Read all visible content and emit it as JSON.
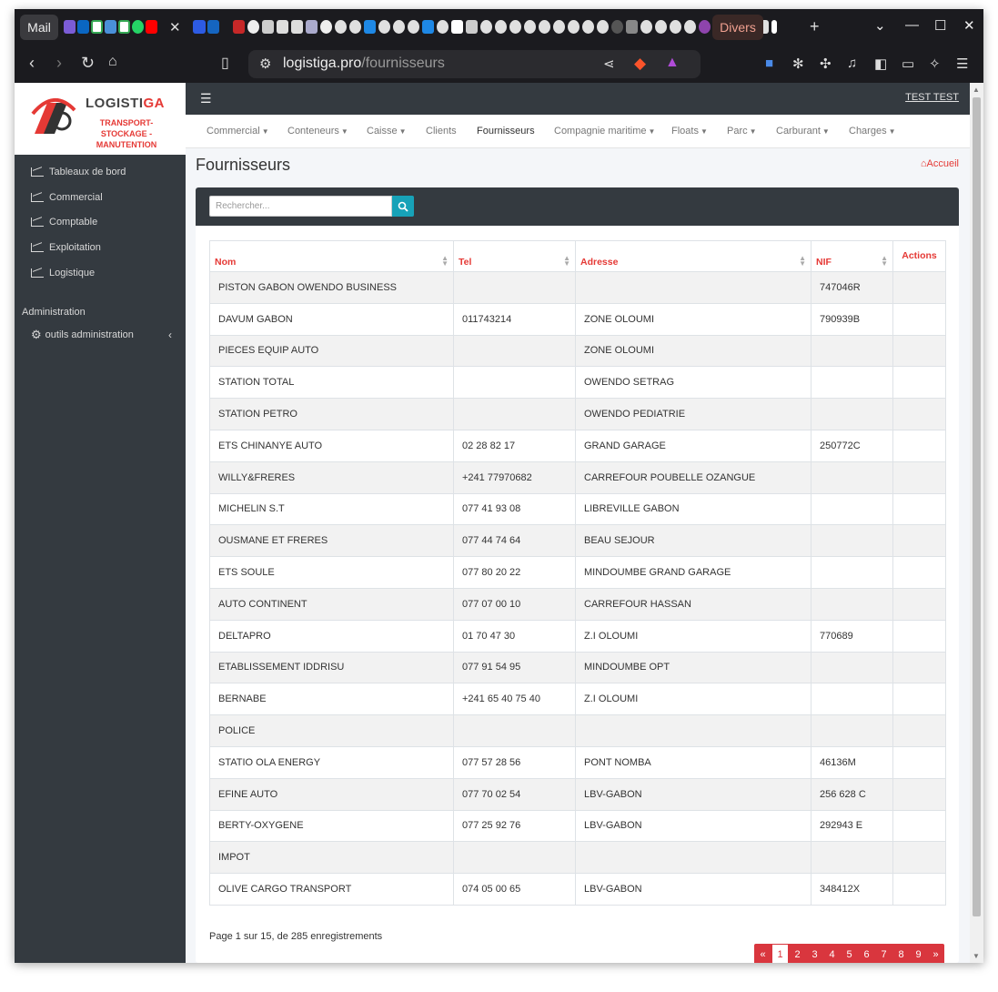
{
  "browser": {
    "tab_mail": "Mail",
    "tab_divers": "Divers",
    "url_host": "logistiga.pro",
    "url_path": "/fournisseurs"
  },
  "brand": {
    "name_main": "LOGISTI",
    "name_accent": "GA",
    "tagline": "TRANSPORT-STOCKAGE -MANUTENTION",
    "accent_color": "#e53935"
  },
  "sidebar": {
    "items": [
      {
        "label": "Tableaux de bord",
        "icon": "chart-line-icon"
      },
      {
        "label": "Commercial",
        "icon": "chart-line-icon"
      },
      {
        "label": "Comptable",
        "icon": "chart-line-icon"
      },
      {
        "label": "Exploitation",
        "icon": "chart-line-icon"
      },
      {
        "label": "Logistique",
        "icon": "chart-line-icon"
      }
    ],
    "section_label": "Administration",
    "admin_item": "outils administration"
  },
  "topbar": {
    "user": "TEST TEST"
  },
  "menu": [
    {
      "label": "Commercial",
      "dropdown": true
    },
    {
      "label": "Conteneurs",
      "dropdown": true
    },
    {
      "label": "Caisse",
      "dropdown": true
    },
    {
      "label": "Clients",
      "dropdown": false
    },
    {
      "label": "Fournisseurs",
      "dropdown": false,
      "active": true
    },
    {
      "label": "Compagnie maritime",
      "dropdown": true
    },
    {
      "label": "Floats",
      "dropdown": true
    },
    {
      "label": "Parc",
      "dropdown": true
    },
    {
      "label": "Carburant",
      "dropdown": true
    },
    {
      "label": "Charges",
      "dropdown": true
    }
  ],
  "page": {
    "title": "Fournisseurs",
    "home_link": "Accueil",
    "search_placeholder": "Rechercher..."
  },
  "table": {
    "columns": [
      "Nom",
      "Tel",
      "Adresse",
      "NIF",
      "Actions"
    ],
    "rows": [
      [
        "PISTON GABON OWENDO BUSINESS",
        "",
        "",
        "747046R"
      ],
      [
        "DAVUM GABON",
        "011743214",
        "ZONE OLOUMI",
        "790939B"
      ],
      [
        "PIECES EQUIP AUTO",
        "",
        "ZONE OLOUMI",
        ""
      ],
      [
        "STATION TOTAL",
        "",
        "OWENDO SETRAG",
        ""
      ],
      [
        "STATION PETRO",
        "",
        "OWENDO PEDIATRIE",
        ""
      ],
      [
        "ETS CHINANYE AUTO",
        "02 28 82 17",
        "GRAND GARAGE",
        "250772C"
      ],
      [
        "WILLY&FRERES",
        "+241 77970682",
        "CARREFOUR POUBELLE OZANGUE",
        ""
      ],
      [
        "MICHELIN S.T",
        "077 41 93 08",
        "LIBREVILLE GABON",
        ""
      ],
      [
        "OUSMANE ET FRERES",
        "077 44 74 64",
        "BEAU SEJOUR",
        ""
      ],
      [
        "ETS SOULE",
        "077 80 20 22",
        "MINDOUMBE GRAND GARAGE",
        ""
      ],
      [
        "AUTO CONTINENT",
        "077 07 00 10",
        "CARREFOUR HASSAN",
        ""
      ],
      [
        "DELTAPRO",
        "01 70 47 30",
        "Z.I OLOUMI",
        "770689"
      ],
      [
        "ETABLISSEMENT IDDRISU",
        "077 91 54 95",
        "MINDOUMBE OPT",
        ""
      ],
      [
        "BERNABE",
        "+241 65 40 75 40",
        "Z.I OLOUMI",
        ""
      ],
      [
        "POLICE",
        "",
        "",
        ""
      ],
      [
        "STATIO OLA ENERGY",
        "077 57 28 56",
        "PONT NOMBA",
        "46136M"
      ],
      [
        "EFINE AUTO",
        "077 70 02 54",
        "LBV-GABON",
        "256 628 C"
      ],
      [
        "BERTY-OXYGENE",
        "077 25 92 76",
        "LBV-GABON",
        "292943 E"
      ],
      [
        "IMPOT",
        "",
        "",
        ""
      ],
      [
        "OLIVE CARGO TRANSPORT",
        "074 05 00 65",
        "LBV-GABON",
        "348412X"
      ]
    ]
  },
  "pagination": {
    "info": "Page 1 sur 15, de 285 enregistrements",
    "prev": "«",
    "current": "1",
    "pages": [
      "2",
      "3",
      "4",
      "5",
      "6",
      "7",
      "8",
      "9"
    ],
    "next": "»"
  }
}
